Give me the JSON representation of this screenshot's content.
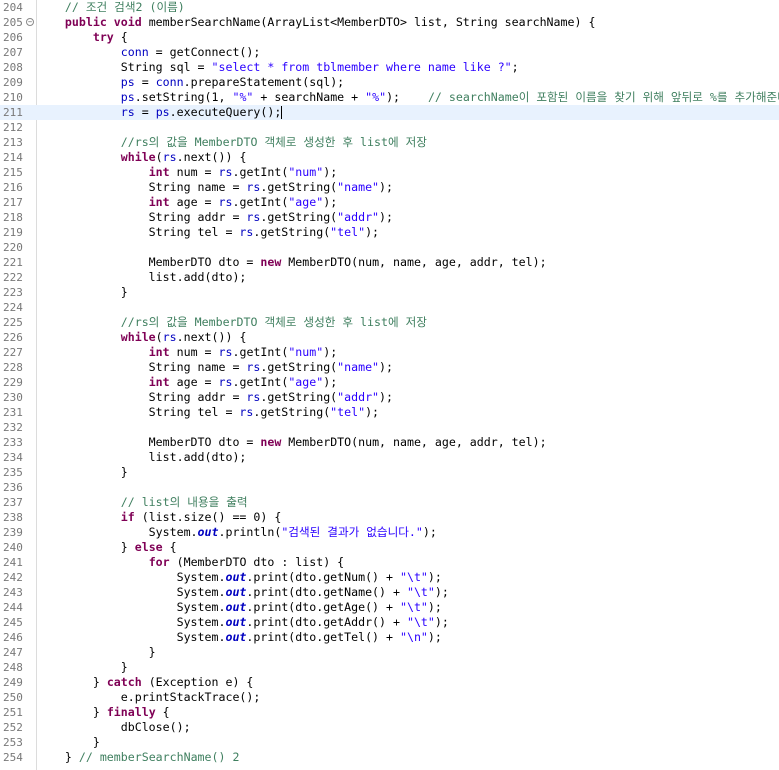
{
  "editor": {
    "current_line": 211,
    "lines": [
      {
        "n": "204",
        "t": [
          [
            "com",
            "    // 조건 검색2 (이름)"
          ]
        ]
      },
      {
        "n": "205",
        "fold": "−",
        "t": [
          [
            "",
            "    "
          ],
          [
            "kw",
            "public"
          ],
          [
            "",
            " "
          ],
          [
            "kw",
            "void"
          ],
          [
            "",
            " memberSearchName(ArrayList<MemberDTO> list, String searchName) {"
          ]
        ]
      },
      {
        "n": "206",
        "t": [
          [
            "",
            "        "
          ],
          [
            "kw",
            "try"
          ],
          [
            "",
            " {"
          ]
        ]
      },
      {
        "n": "207",
        "t": [
          [
            "",
            "            "
          ],
          [
            "fld",
            "conn"
          ],
          [
            "",
            " = getConnect();"
          ]
        ]
      },
      {
        "n": "208",
        "t": [
          [
            "",
            "            String sql = "
          ],
          [
            "str",
            "\"select * from tblmember where name like ?\""
          ],
          [
            "",
            ";"
          ]
        ]
      },
      {
        "n": "209",
        "t": [
          [
            "",
            "            "
          ],
          [
            "fld",
            "ps"
          ],
          [
            "",
            " = "
          ],
          [
            "fld",
            "conn"
          ],
          [
            "",
            ".prepareStatement(sql);"
          ]
        ]
      },
      {
        "n": "210",
        "t": [
          [
            "",
            "            "
          ],
          [
            "fld",
            "ps"
          ],
          [
            "",
            ".setString(1, "
          ],
          [
            "str",
            "\"%\""
          ],
          [
            "",
            " + searchName + "
          ],
          [
            "str",
            "\"%\""
          ],
          [
            "",
            ");    "
          ],
          [
            "com",
            "// searchName이 포함된 이름을 찾기 위해 앞뒤로 %를 추가해준다."
          ]
        ]
      },
      {
        "n": "211",
        "current": true,
        "caret": true,
        "t": [
          [
            "",
            "            "
          ],
          [
            "fld",
            "rs"
          ],
          [
            "",
            " = "
          ],
          [
            "fld",
            "ps"
          ],
          [
            "",
            ".executeQuery();"
          ]
        ]
      },
      {
        "n": "212",
        "t": []
      },
      {
        "n": "213",
        "t": [
          [
            "",
            "            "
          ],
          [
            "com",
            "//rs의 값을 MemberDTO 객체로 생성한 후 list에 저장"
          ]
        ]
      },
      {
        "n": "214",
        "t": [
          [
            "",
            "            "
          ],
          [
            "kw",
            "while"
          ],
          [
            "",
            "("
          ],
          [
            "fld",
            "rs"
          ],
          [
            "",
            ".next()) {"
          ]
        ]
      },
      {
        "n": "215",
        "t": [
          [
            "",
            "                "
          ],
          [
            "kw",
            "int"
          ],
          [
            "",
            " num = "
          ],
          [
            "fld",
            "rs"
          ],
          [
            "",
            ".getInt("
          ],
          [
            "str",
            "\"num\""
          ],
          [
            "",
            ");"
          ]
        ]
      },
      {
        "n": "216",
        "t": [
          [
            "",
            "                String name = "
          ],
          [
            "fld",
            "rs"
          ],
          [
            "",
            ".getString("
          ],
          [
            "str",
            "\"name\""
          ],
          [
            "",
            ");"
          ]
        ]
      },
      {
        "n": "217",
        "t": [
          [
            "",
            "                "
          ],
          [
            "kw",
            "int"
          ],
          [
            "",
            " age = "
          ],
          [
            "fld",
            "rs"
          ],
          [
            "",
            ".getInt("
          ],
          [
            "str",
            "\"age\""
          ],
          [
            "",
            ");"
          ]
        ]
      },
      {
        "n": "218",
        "t": [
          [
            "",
            "                String addr = "
          ],
          [
            "fld",
            "rs"
          ],
          [
            "",
            ".getString("
          ],
          [
            "str",
            "\"addr\""
          ],
          [
            "",
            ");"
          ]
        ]
      },
      {
        "n": "219",
        "t": [
          [
            "",
            "                String tel = "
          ],
          [
            "fld",
            "rs"
          ],
          [
            "",
            ".getString("
          ],
          [
            "str",
            "\"tel\""
          ],
          [
            "",
            ");"
          ]
        ]
      },
      {
        "n": "220",
        "t": []
      },
      {
        "n": "221",
        "t": [
          [
            "",
            "                MemberDTO dto = "
          ],
          [
            "kw",
            "new"
          ],
          [
            "",
            " MemberDTO(num, name, age, addr, tel);"
          ]
        ]
      },
      {
        "n": "222",
        "t": [
          [
            "",
            "                list.add(dto);"
          ]
        ]
      },
      {
        "n": "223",
        "t": [
          [
            "",
            "            }"
          ]
        ]
      },
      {
        "n": "224",
        "t": []
      },
      {
        "n": "225",
        "t": [
          [
            "",
            "            "
          ],
          [
            "com",
            "//rs의 값을 MemberDTO 객체로 생성한 후 list에 저장"
          ]
        ]
      },
      {
        "n": "226",
        "t": [
          [
            "",
            "            "
          ],
          [
            "kw",
            "while"
          ],
          [
            "",
            "("
          ],
          [
            "fld",
            "rs"
          ],
          [
            "",
            ".next()) {"
          ]
        ]
      },
      {
        "n": "227",
        "t": [
          [
            "",
            "                "
          ],
          [
            "kw",
            "int"
          ],
          [
            "",
            " num = "
          ],
          [
            "fld",
            "rs"
          ],
          [
            "",
            ".getInt("
          ],
          [
            "str",
            "\"num\""
          ],
          [
            "",
            ");"
          ]
        ]
      },
      {
        "n": "228",
        "t": [
          [
            "",
            "                String name = "
          ],
          [
            "fld",
            "rs"
          ],
          [
            "",
            ".getString("
          ],
          [
            "str",
            "\"name\""
          ],
          [
            "",
            ");"
          ]
        ]
      },
      {
        "n": "229",
        "t": [
          [
            "",
            "                "
          ],
          [
            "kw",
            "int"
          ],
          [
            "",
            " age = "
          ],
          [
            "fld",
            "rs"
          ],
          [
            "",
            ".getInt("
          ],
          [
            "str",
            "\"age\""
          ],
          [
            "",
            ");"
          ]
        ]
      },
      {
        "n": "230",
        "t": [
          [
            "",
            "                String addr = "
          ],
          [
            "fld",
            "rs"
          ],
          [
            "",
            ".getString("
          ],
          [
            "str",
            "\"addr\""
          ],
          [
            "",
            ");"
          ]
        ]
      },
      {
        "n": "231",
        "t": [
          [
            "",
            "                String tel = "
          ],
          [
            "fld",
            "rs"
          ],
          [
            "",
            ".getString("
          ],
          [
            "str",
            "\"tel\""
          ],
          [
            "",
            ");"
          ]
        ]
      },
      {
        "n": "232",
        "t": []
      },
      {
        "n": "233",
        "t": [
          [
            "",
            "                MemberDTO dto = "
          ],
          [
            "kw",
            "new"
          ],
          [
            "",
            " MemberDTO(num, name, age, addr, tel);"
          ]
        ]
      },
      {
        "n": "234",
        "t": [
          [
            "",
            "                list.add(dto);"
          ]
        ]
      },
      {
        "n": "235",
        "t": [
          [
            "",
            "            }"
          ]
        ]
      },
      {
        "n": "236",
        "t": []
      },
      {
        "n": "237",
        "t": [
          [
            "",
            "            "
          ],
          [
            "com",
            "// list의 내용을 출력"
          ]
        ]
      },
      {
        "n": "238",
        "t": [
          [
            "",
            "            "
          ],
          [
            "kw",
            "if"
          ],
          [
            "",
            " (list.size() == 0) {"
          ]
        ]
      },
      {
        "n": "239",
        "t": [
          [
            "",
            "                System."
          ],
          [
            "sfld",
            "out"
          ],
          [
            "",
            ".println("
          ],
          [
            "str",
            "\"검색된 결과가 없습니다.\""
          ],
          [
            "",
            ");"
          ]
        ]
      },
      {
        "n": "240",
        "t": [
          [
            "",
            "            } "
          ],
          [
            "kw",
            "else"
          ],
          [
            "",
            " {"
          ]
        ]
      },
      {
        "n": "241",
        "t": [
          [
            "",
            "                "
          ],
          [
            "kw",
            "for"
          ],
          [
            "",
            " (MemberDTO dto : list) {"
          ]
        ]
      },
      {
        "n": "242",
        "t": [
          [
            "",
            "                    System."
          ],
          [
            "sfld",
            "out"
          ],
          [
            "",
            ".print(dto.getNum() + "
          ],
          [
            "str",
            "\"\\t\""
          ],
          [
            "",
            ");"
          ]
        ]
      },
      {
        "n": "243",
        "t": [
          [
            "",
            "                    System."
          ],
          [
            "sfld",
            "out"
          ],
          [
            "",
            ".print(dto.getName() + "
          ],
          [
            "str",
            "\"\\t\""
          ],
          [
            "",
            ");"
          ]
        ]
      },
      {
        "n": "244",
        "t": [
          [
            "",
            "                    System."
          ],
          [
            "sfld",
            "out"
          ],
          [
            "",
            ".print(dto.getAge() + "
          ],
          [
            "str",
            "\"\\t\""
          ],
          [
            "",
            ");"
          ]
        ]
      },
      {
        "n": "245",
        "t": [
          [
            "",
            "                    System."
          ],
          [
            "sfld",
            "out"
          ],
          [
            "",
            ".print(dto.getAddr() + "
          ],
          [
            "str",
            "\"\\t\""
          ],
          [
            "",
            ");"
          ]
        ]
      },
      {
        "n": "246",
        "t": [
          [
            "",
            "                    System."
          ],
          [
            "sfld",
            "out"
          ],
          [
            "",
            ".print(dto.getTel() + "
          ],
          [
            "str",
            "\"\\n\""
          ],
          [
            "",
            ");"
          ]
        ]
      },
      {
        "n": "247",
        "t": [
          [
            "",
            "                }"
          ]
        ]
      },
      {
        "n": "248",
        "t": [
          [
            "",
            "            }"
          ]
        ]
      },
      {
        "n": "249",
        "t": [
          [
            "",
            "        } "
          ],
          [
            "kw",
            "catch"
          ],
          [
            "",
            " (Exception e) {"
          ]
        ]
      },
      {
        "n": "250",
        "t": [
          [
            "",
            "            e.printStackTrace();"
          ]
        ]
      },
      {
        "n": "251",
        "t": [
          [
            "",
            "        } "
          ],
          [
            "kw",
            "finally"
          ],
          [
            "",
            " {"
          ]
        ]
      },
      {
        "n": "252",
        "t": [
          [
            "",
            "            dbClose();"
          ]
        ]
      },
      {
        "n": "253",
        "t": [
          [
            "",
            "        }"
          ]
        ]
      },
      {
        "n": "254",
        "t": [
          [
            "",
            "    } "
          ],
          [
            "com",
            "// memberSearchName() 2"
          ]
        ]
      }
    ]
  },
  "colors": {
    "keyword": "#7f0055",
    "string": "#2a00ff",
    "comment": "#3f7f5f",
    "field": "#0000c0",
    "line_number": "#787878",
    "current_line_bg": "#e8f2fe"
  }
}
